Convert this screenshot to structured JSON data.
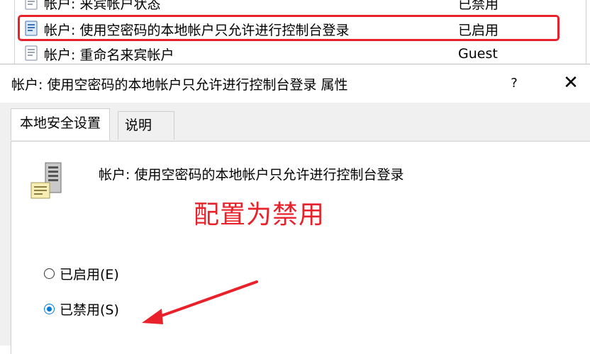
{
  "policy_list": {
    "rows": [
      {
        "name": "帐户: 来宾帐户状态",
        "value": "已禁用",
        "icon": "policy-icon"
      },
      {
        "name": "帐户: 使用空密码的本地帐户只允许进行控制台登录",
        "value": "已启用",
        "icon": "policy-icon"
      },
      {
        "name": "帐户: 重命名来宾帐户",
        "value": "Guest",
        "icon": "policy-icon"
      }
    ]
  },
  "dialog": {
    "title": "帐户: 使用空密码的本地帐户只允许进行控制台登录 属性",
    "help_label": "?",
    "close_label": "✕",
    "tabs": [
      {
        "label": "本地安全设置",
        "active": true
      },
      {
        "label": "说明",
        "active": false
      }
    ],
    "policy_heading": "帐户: 使用空密码的本地帐户只允许进行控制台登录",
    "icon": "server-icon",
    "options": [
      {
        "label": "已启用(E)",
        "checked": false
      },
      {
        "label": "已禁用(S)",
        "checked": true
      }
    ]
  },
  "annotation": {
    "text": "配置为禁用",
    "color": "#e8212a"
  },
  "colors": {
    "highlight": "#e8212a",
    "radio_accent": "#0078d7",
    "dialog_bg": "#f0f0f0"
  }
}
